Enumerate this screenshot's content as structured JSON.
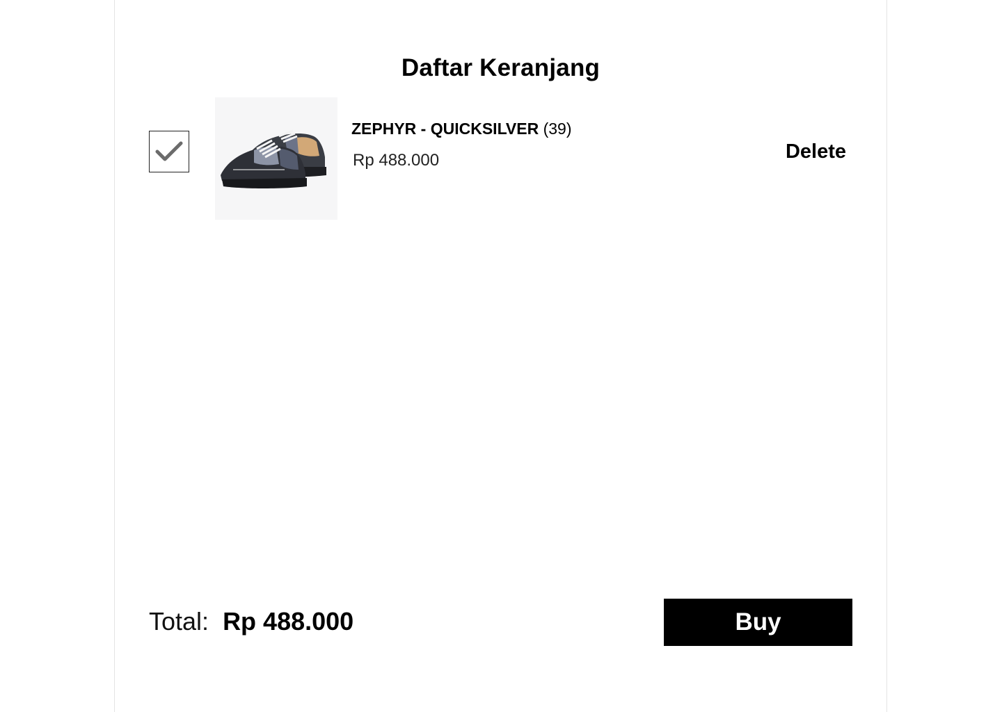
{
  "page_title": "Daftar Keranjang",
  "cart": {
    "items": [
      {
        "checked": true,
        "image_icon": "sneaker-image",
        "name": "ZEPHYR - QUICKSILVER",
        "size": "(39)",
        "price": "Rp 488.000",
        "delete_label": "Delete"
      }
    ]
  },
  "footer": {
    "total_label": "Total:",
    "total_amount": "Rp 488.000",
    "buy_label": "Buy"
  },
  "colors": {
    "primary": "#000000",
    "background": "#ffffff",
    "checkmark": "#6b6b6b"
  }
}
